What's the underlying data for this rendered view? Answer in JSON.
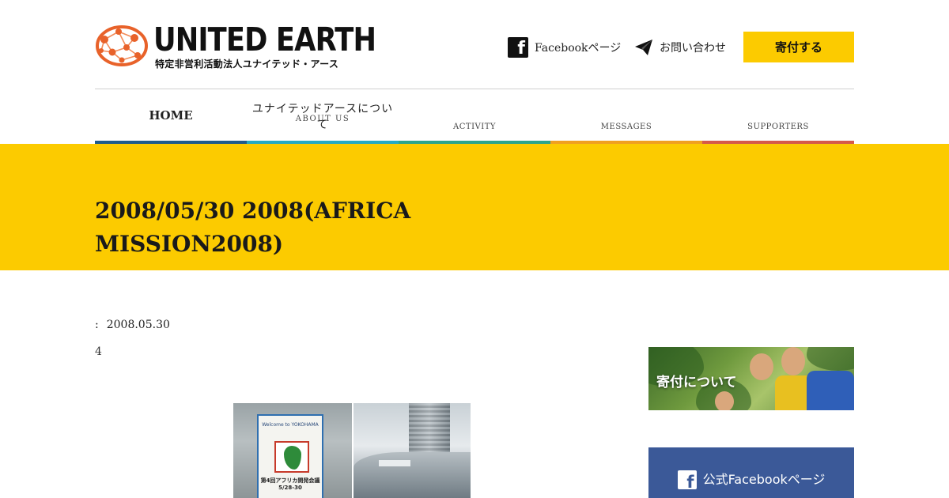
{
  "brand": {
    "title": "UNITED EARTH",
    "subtitle": "特定非営利活動法人ユナイテッド・アース",
    "logo_colors": [
      "#e8622a",
      "#f28c5a"
    ]
  },
  "header": {
    "facebook_label": "Facebookページ",
    "contact_label": "お問い合わせ",
    "donate_label": "寄付する",
    "donate_color": "#fccb00"
  },
  "nav": {
    "items": [
      {
        "label": "HOME",
        "sub": "",
        "color": "#1e5b8c"
      },
      {
        "label": "ユナイテッドアースについて",
        "sub": "ABOUT US",
        "color": "#25aac3"
      },
      {
        "label": "",
        "sub": "ACTIVITY",
        "color": "#2aa58d"
      },
      {
        "label": "",
        "sub": "MESSAGES",
        "color": "#f0a020"
      },
      {
        "label": "",
        "sub": "SUPPORTERS",
        "color": "#d55a4a"
      }
    ]
  },
  "hero": {
    "title": "2008/05/30 2008(AFRICA MISSION2008)",
    "bg_color": "#fccb00"
  },
  "post": {
    "date_sep": ":",
    "date": "2008.05.30",
    "body": "4",
    "photos": {
      "poster_welcome": "Welcome to YOKOHAMA",
      "poster_caption": "第4回アフリカ開発会議 5/28-30"
    }
  },
  "sidebar": {
    "donate_label": "寄付について",
    "facebook_label": "公式Facebookページ",
    "facebook_color": "#3b5998"
  }
}
